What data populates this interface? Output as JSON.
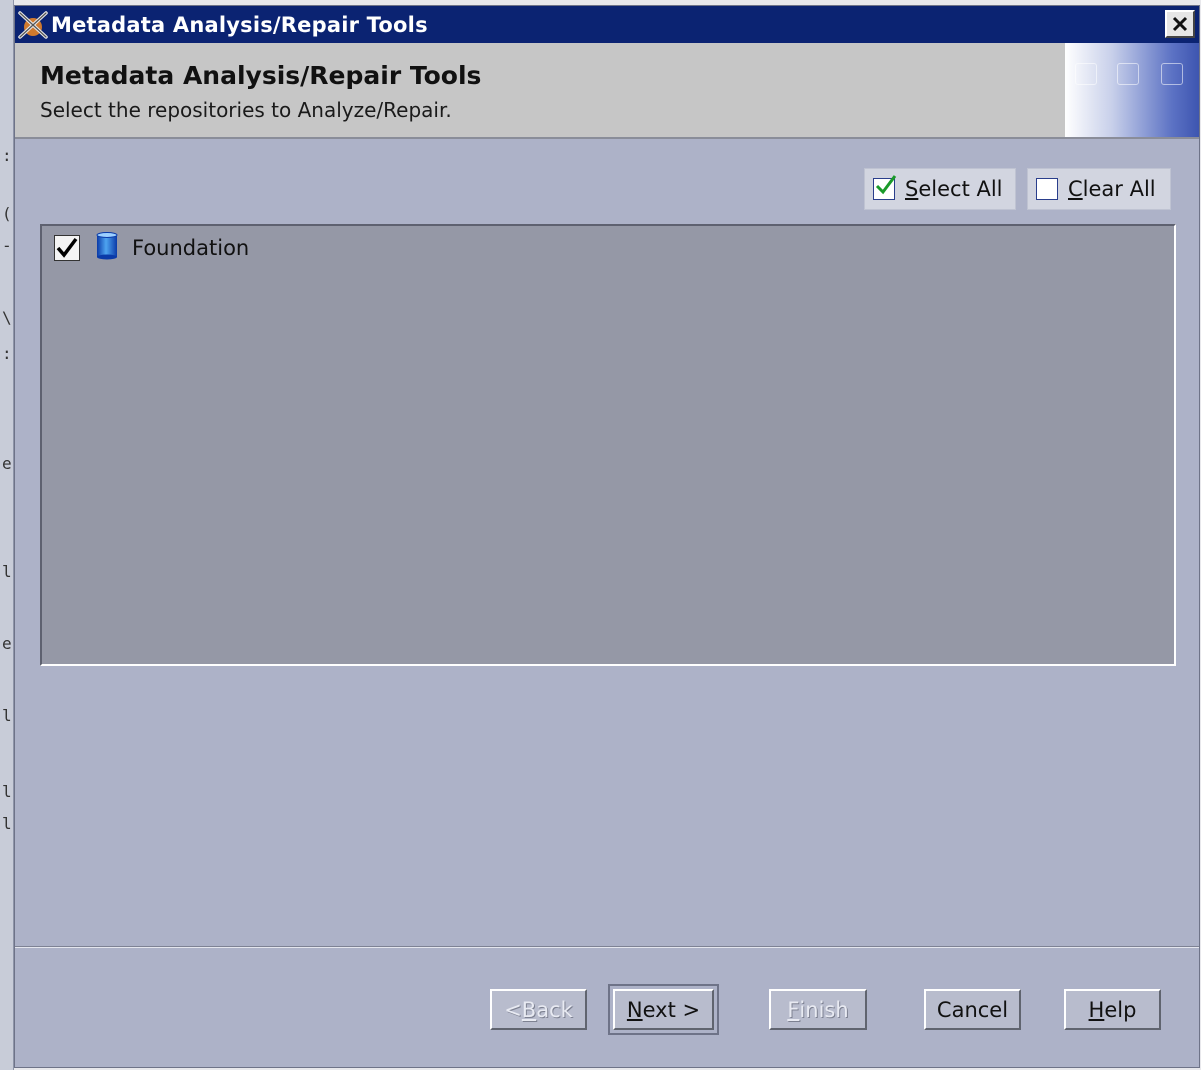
{
  "window": {
    "title": "Metadata Analysis/Repair Tools",
    "close_symbol": "X"
  },
  "header": {
    "title": "Metadata Analysis/Repair Tools",
    "subtitle": "Select the repositories to Analyze/Repair."
  },
  "toolbar": {
    "select_all_mnemonic": "S",
    "select_all_rest": "elect All",
    "clear_all_mnemonic": "C",
    "clear_all_rest": "lear All"
  },
  "repositories": [
    {
      "label": "Foundation",
      "checked": true,
      "icon": "database-cylinder-icon"
    }
  ],
  "footer": {
    "back_prefix": "< ",
    "back_mnemonic": "B",
    "back_rest": "ack",
    "next_mnemonic": "N",
    "next_rest": "ext >",
    "finish_mnemonic": "F",
    "finish_rest": "inish",
    "cancel_label": "Cancel",
    "help_mnemonic": "H",
    "help_rest": "elp"
  },
  "colors": {
    "titlebar": "#0b2372",
    "panel": "#adb2c8",
    "list_background": "#9598a6",
    "header_band": "#c6c6c6"
  }
}
